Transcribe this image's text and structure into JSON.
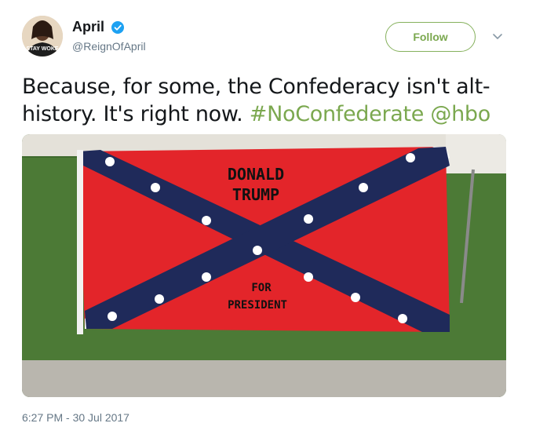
{
  "author": {
    "display_name": "April",
    "handle": "@ReignOfApril",
    "avatar_shirt_text": "STAY WOKE",
    "verified": true
  },
  "follow_label": "Follow",
  "tweet": {
    "text": "Because, for some, the Confederacy isn't alt-history. It's right now.",
    "hashtag": "#NoConfederate",
    "mention": "@hbo"
  },
  "media": {
    "flag_text_line1": "DONALD",
    "flag_text_line2": "TRUMP",
    "flag_text_line3": "FOR",
    "flag_text_line4": "PRESIDENT"
  },
  "timestamp": "6:27 PM - 30 Jul 2017",
  "colors": {
    "accent": "#7ba84f",
    "muted": "#657786",
    "verified_blue": "#1da1f2"
  },
  "icons": {
    "verified": "verified-badge-icon",
    "caret": "chevron-down-icon"
  }
}
